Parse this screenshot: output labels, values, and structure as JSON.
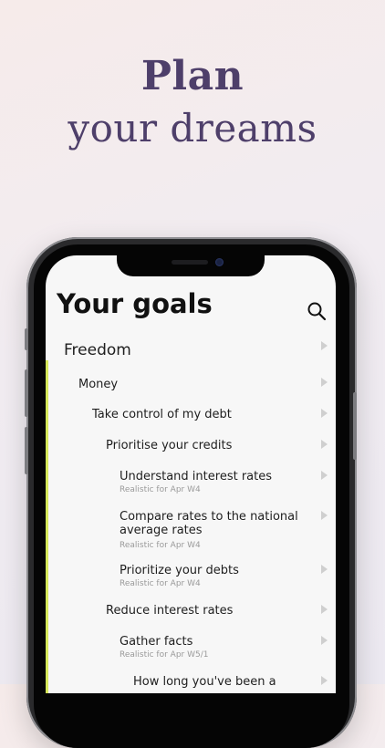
{
  "headline": {
    "line1": "Plan",
    "line2": "your dreams"
  },
  "screen": {
    "title": "Your goals",
    "search_icon": "search-icon",
    "accent_color": "#d6e85a",
    "goals": [
      {
        "label": "Freedom",
        "sub": ""
      },
      {
        "label": "Money",
        "sub": ""
      },
      {
        "label": "Take control of my debt",
        "sub": ""
      },
      {
        "label": "Prioritise your credits",
        "sub": ""
      },
      {
        "label": "Understand interest rates",
        "sub": "Realistic for Apr W4"
      },
      {
        "label": "Compare rates to the national average rates",
        "sub": "Realistic for Apr W4"
      },
      {
        "label": "Prioritize your debts",
        "sub": "Realistic for Apr W4"
      },
      {
        "label": "Reduce interest rates",
        "sub": ""
      },
      {
        "label": "Gather facts",
        "sub": "Realistic for Apr W5/1"
      },
      {
        "label": "How long you've been a",
        "sub": ""
      }
    ]
  }
}
